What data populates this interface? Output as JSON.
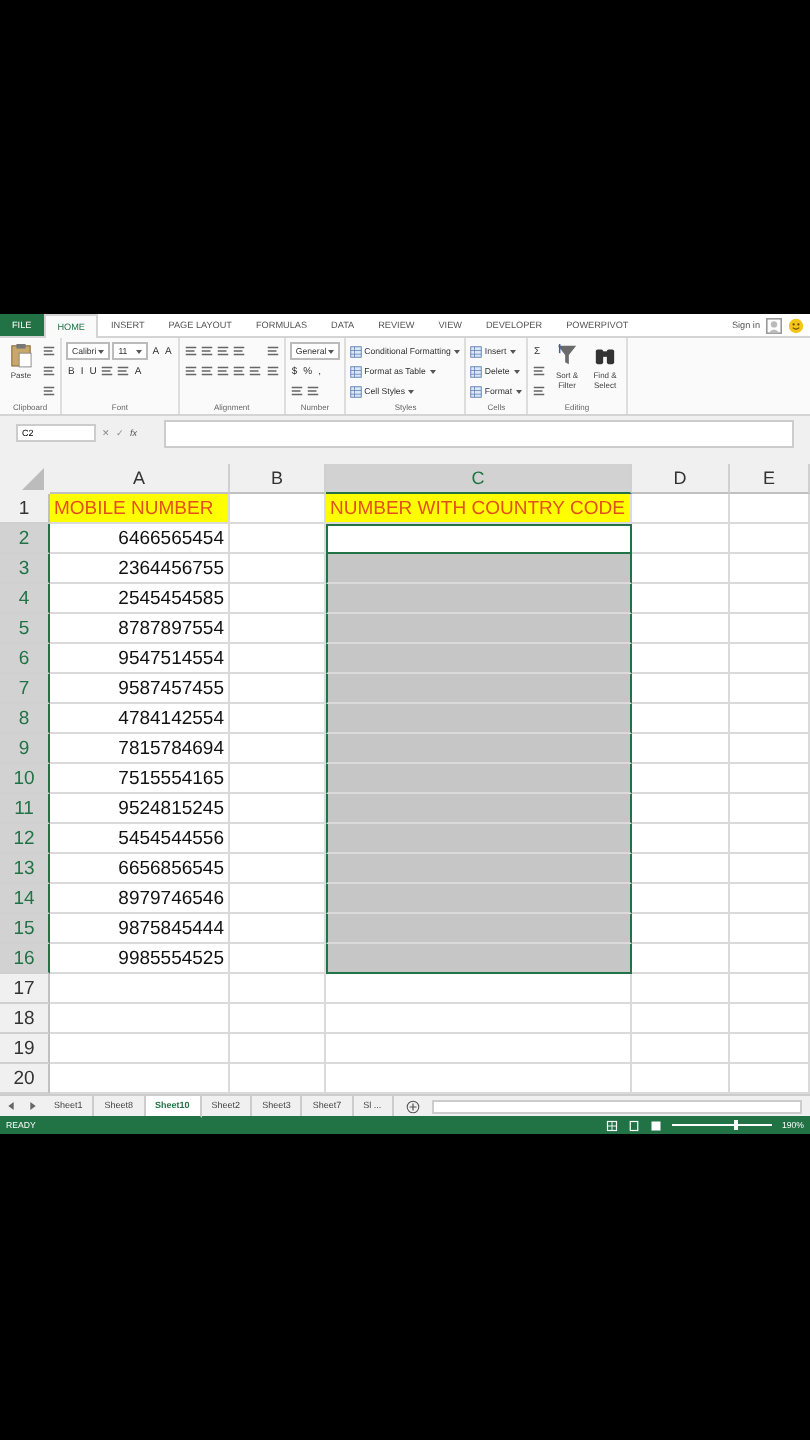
{
  "ribbon_tabs": [
    {
      "label": "FILE",
      "kind": "file",
      "selected": false
    },
    {
      "label": "HOME",
      "kind": "tab",
      "selected": true
    },
    {
      "label": "INSERT",
      "kind": "tab",
      "selected": false
    },
    {
      "label": "PAGE LAYOUT",
      "kind": "tab",
      "selected": false
    },
    {
      "label": "FORMULAS",
      "kind": "tab",
      "selected": false
    },
    {
      "label": "DATA",
      "kind": "tab",
      "selected": false
    },
    {
      "label": "REVIEW",
      "kind": "tab",
      "selected": false
    },
    {
      "label": "VIEW",
      "kind": "tab",
      "selected": false
    },
    {
      "label": "DEVELOPER",
      "kind": "tab",
      "selected": false
    },
    {
      "label": "POWERPIVOT",
      "kind": "tab",
      "selected": false
    }
  ],
  "account": {
    "sign_in": "Sign in"
  },
  "ribbon_groups": [
    {
      "label": "Clipboard",
      "items": [
        {
          "kind": "big",
          "label": "Paste"
        },
        {
          "kind": "stack",
          "lines": [
            [
              {
                "kind": "icon"
              }
            ],
            [
              {
                "kind": "icon"
              }
            ],
            [
              {
                "kind": "icon"
              }
            ]
          ]
        }
      ]
    },
    {
      "label": "Font",
      "items": [
        {
          "kind": "stack",
          "lines": [
            [
              {
                "kind": "select",
                "label": "Calibri"
              },
              {
                "kind": "select",
                "label": "11"
              },
              {
                "kind": "glyph",
                "label": "A"
              },
              {
                "kind": "glyph",
                "label": "A"
              }
            ],
            [
              {
                "kind": "glyph",
                "label": "B"
              },
              {
                "kind": "glyph",
                "label": "I"
              },
              {
                "kind": "glyph",
                "label": "U"
              },
              {
                "kind": "icon"
              },
              {
                "kind": "icon"
              },
              {
                "kind": "glyph",
                "label": "A"
              }
            ]
          ]
        }
      ]
    },
    {
      "label": "Alignment",
      "items": [
        {
          "kind": "stack",
          "lines": [
            [
              {
                "kind": "icon"
              },
              {
                "kind": "icon"
              },
              {
                "kind": "icon"
              },
              {
                "kind": "icon"
              }
            ],
            [
              {
                "kind": "icon"
              },
              {
                "kind": "icon"
              },
              {
                "kind": "icon"
              },
              {
                "kind": "icon"
              },
              {
                "kind": "icon"
              }
            ]
          ]
        },
        {
          "kind": "stack",
          "lines": [
            [
              {
                "kind": "icon"
              }
            ],
            [
              {
                "kind": "icon"
              }
            ]
          ]
        }
      ]
    },
    {
      "label": "Number",
      "items": [
        {
          "kind": "stack",
          "lines": [
            [
              {
                "kind": "select",
                "label": "General"
              }
            ],
            [
              {
                "kind": "glyph",
                "label": "$"
              },
              {
                "kind": "glyph",
                "label": "%"
              },
              {
                "kind": "glyph",
                "label": ","
              }
            ],
            [
              {
                "kind": "icon"
              },
              {
                "kind": "icon"
              }
            ]
          ]
        }
      ]
    },
    {
      "label": "Styles",
      "items": [
        {
          "kind": "stack",
          "lines": [
            [
              {
                "kind": "menu",
                "label": "Conditional Formatting"
              }
            ],
            [
              {
                "kind": "menu",
                "label": "Format as Table"
              }
            ],
            [
              {
                "kind": "menu",
                "label": "Cell Styles"
              }
            ]
          ]
        }
      ]
    },
    {
      "label": "Cells",
      "items": [
        {
          "kind": "stack",
          "lines": [
            [
              {
                "kind": "menu",
                "label": "Insert"
              }
            ],
            [
              {
                "kind": "menu",
                "label": "Delete"
              }
            ],
            [
              {
                "kind": "menu",
                "label": "Format"
              }
            ]
          ]
        }
      ]
    },
    {
      "label": "Editing",
      "items": [
        {
          "kind": "stack",
          "lines": [
            [
              {
                "kind": "glyph",
                "label": "Σ"
              }
            ],
            [
              {
                "kind": "icon"
              }
            ],
            [
              {
                "kind": "icon"
              }
            ]
          ]
        },
        {
          "kind": "big",
          "label": "Sort & Filter"
        },
        {
          "kind": "big",
          "label": "Find & Select"
        }
      ]
    }
  ],
  "formula_bar": {
    "name_box": "C2",
    "cancel": "✕",
    "enter": "✓",
    "fx": "fx"
  },
  "columns": [
    {
      "label": "A",
      "selected": false
    },
    {
      "label": "B",
      "selected": false
    },
    {
      "label": "C",
      "selected": true
    },
    {
      "label": "D",
      "selected": false
    },
    {
      "label": "E",
      "selected": false
    }
  ],
  "rows": [
    {
      "number": "1",
      "selected": false,
      "active": false,
      "kind": "header",
      "a": "MOBILE NUMBER",
      "c": "NUMBER WITH COUNTRY CODE"
    },
    {
      "number": "2",
      "selected": true,
      "active": true,
      "kind": "data",
      "a": "6466565454"
    },
    {
      "number": "3",
      "selected": true,
      "active": false,
      "kind": "data",
      "a": "2364456755"
    },
    {
      "number": "4",
      "selected": true,
      "active": false,
      "kind": "data",
      "a": "2545454585"
    },
    {
      "number": "5",
      "selected": true,
      "active": false,
      "kind": "data",
      "a": "8787897554"
    },
    {
      "number": "6",
      "selected": true,
      "active": false,
      "kind": "data",
      "a": "9547514554"
    },
    {
      "number": "7",
      "selected": true,
      "active": false,
      "kind": "data",
      "a": "9587457455"
    },
    {
      "number": "8",
      "selected": true,
      "active": false,
      "kind": "data",
      "a": "4784142554"
    },
    {
      "number": "9",
      "selected": true,
      "active": false,
      "kind": "data",
      "a": "7815784694"
    },
    {
      "number": "10",
      "selected": true,
      "active": false,
      "kind": "data",
      "a": "7515554165"
    },
    {
      "number": "11",
      "selected": true,
      "active": false,
      "kind": "data",
      "a": "9524815245"
    },
    {
      "number": "12",
      "selected": true,
      "active": false,
      "kind": "data",
      "a": "5454544556"
    },
    {
      "number": "13",
      "selected": true,
      "active": false,
      "kind": "data",
      "a": "6656856545"
    },
    {
      "number": "14",
      "selected": true,
      "active": false,
      "kind": "data",
      "a": "8979746546"
    },
    {
      "number": "15",
      "selected": true,
      "active": false,
      "kind": "data",
      "a": "9875845444"
    },
    {
      "number": "16",
      "selected": true,
      "active": false,
      "kind": "data",
      "a": "9985554525"
    },
    {
      "number": "17",
      "selected": false,
      "active": false,
      "kind": "data"
    },
    {
      "number": "18",
      "selected": false,
      "active": false,
      "kind": "data"
    },
    {
      "number": "19",
      "selected": false,
      "active": false,
      "kind": "data"
    },
    {
      "number": "20",
      "selected": false,
      "active": false,
      "kind": "data"
    }
  ],
  "sheet_tabs": [
    {
      "label": "Sheet1",
      "selected": false
    },
    {
      "label": "Sheet8",
      "selected": false
    },
    {
      "label": "Sheet10",
      "selected": true
    },
    {
      "label": "Sheet2",
      "selected": false
    },
    {
      "label": "Sheet3",
      "selected": false
    },
    {
      "label": "Sheet7",
      "selected": false
    },
    {
      "label": "Sl ...",
      "selected": false
    }
  ],
  "status_bar": {
    "mode": "READY",
    "zoom": "190%",
    "zoom_slider": {
      "level": 0.62
    }
  }
}
